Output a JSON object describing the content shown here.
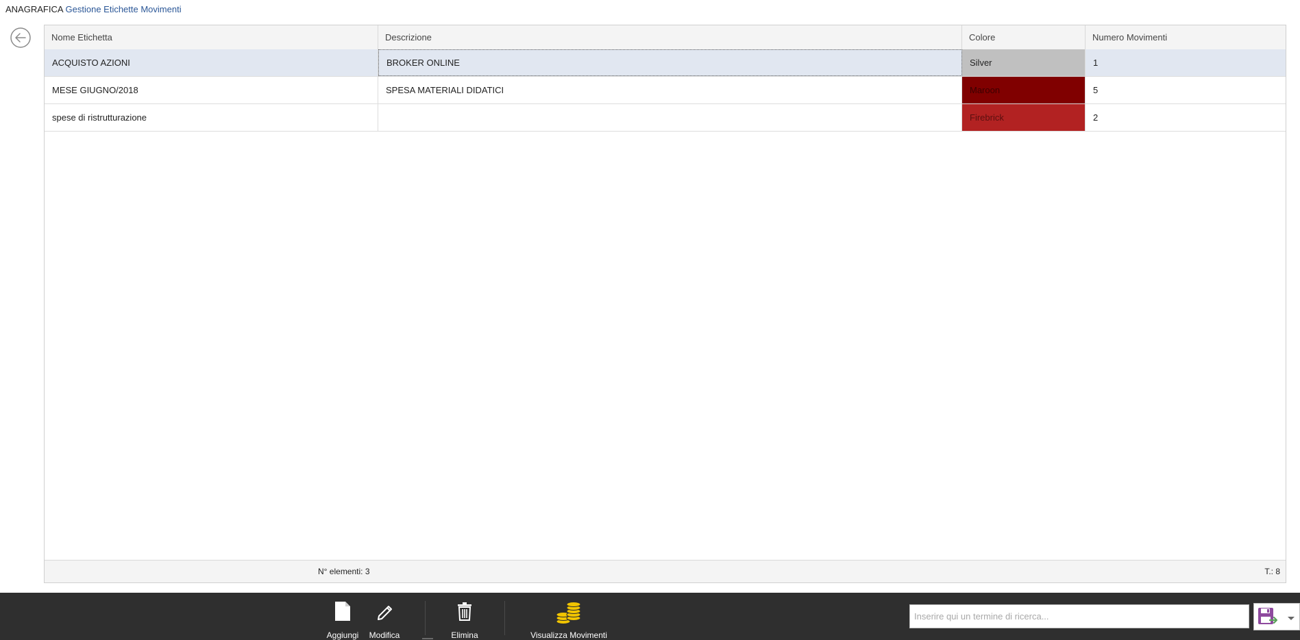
{
  "breadcrumb": {
    "root": "ANAGRAFICA",
    "current": "Gestione Etichette Movimenti"
  },
  "back_icon": "arrow-left-circle-icon",
  "grid": {
    "columns": [
      "Nome Etichetta",
      "Descrizione",
      "Colore",
      "Numero Movimenti"
    ],
    "rows": [
      {
        "name": "ACQUISTO AZIONI",
        "description": "BROKER ONLINE",
        "color_name": "Silver",
        "color_hex": "#c0c0c0",
        "count": "1",
        "selected": true
      },
      {
        "name": "MESE GIUGNO/2018",
        "description": "SPESA MATERIALI DIDATICI",
        "color_name": "Maroon",
        "color_hex": "#800000",
        "count": "5",
        "selected": false
      },
      {
        "name": "spese di ristrutturazione",
        "description": "",
        "color_name": "Firebrick",
        "color_hex": "#b22222",
        "count": "2",
        "selected": false
      }
    ],
    "footer": {
      "count_label": "N° elementi: 3",
      "t_label": "T.: 8"
    }
  },
  "toolbar": {
    "add_label": "Aggiungi",
    "edit_label": "Modifica",
    "delete_label": "Elimina",
    "view_label": "Visualizza Movimenti",
    "icons": {
      "add": "new-document-icon",
      "edit": "pencil-icon",
      "delete": "trash-icon",
      "view": "coins-icon",
      "save": "save-export-icon",
      "menu": "chevron-down-icon"
    }
  },
  "search": {
    "placeholder": "Inserire qui un termine di ricerca...",
    "value": ""
  },
  "colors": {
    "toolbar_bg": "#2f2f2f",
    "selected_row": "#e1e7f1",
    "link_blue": "#2b5797",
    "coins": "#f2c500",
    "save_purple": "#8e4a9e"
  }
}
